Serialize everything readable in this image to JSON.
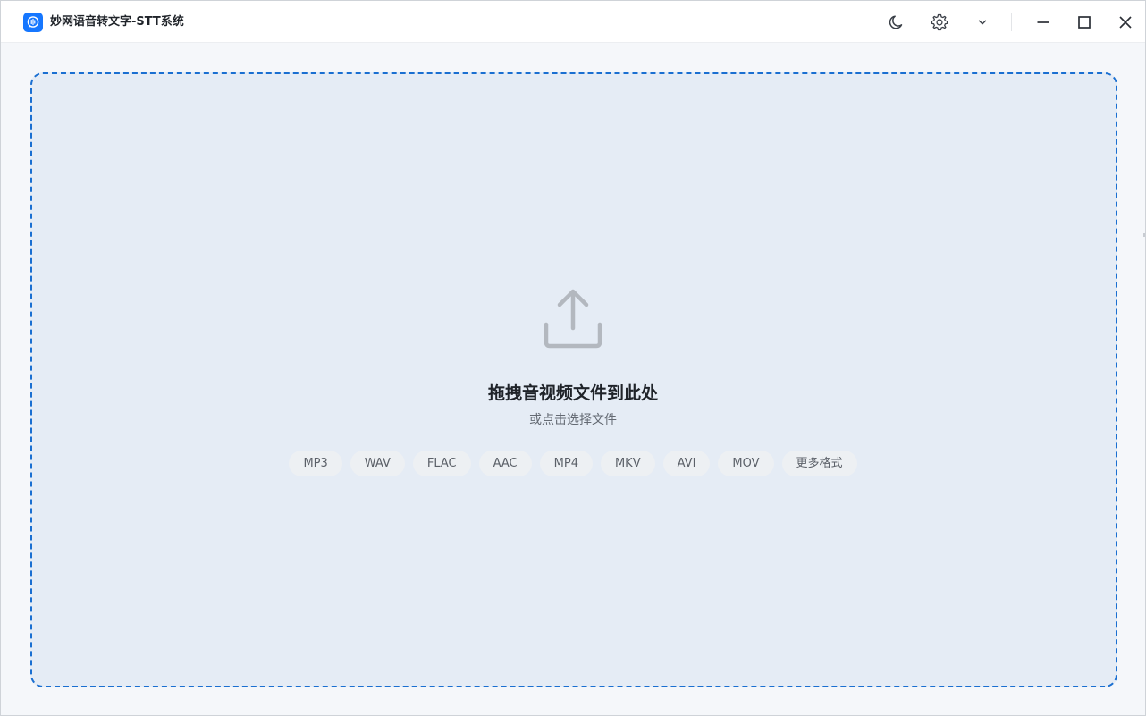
{
  "app": {
    "title": "妙网语音转文字-STT系统",
    "logo_icon": "waveform-chat-icon",
    "accent_color": "#1677ff"
  },
  "titlebar": {
    "buttons": [
      {
        "name": "theme-toggle",
        "icon": "moon-icon"
      },
      {
        "name": "settings",
        "icon": "gear-icon"
      },
      {
        "name": "menu-dropdown",
        "icon": "chevron-down-icon"
      },
      {
        "name": "minimize",
        "icon": "minimize-icon"
      },
      {
        "name": "maximize",
        "icon": "maximize-icon"
      },
      {
        "name": "close",
        "icon": "close-icon"
      }
    ]
  },
  "dropzone": {
    "icon": "upload-icon",
    "title": "拖拽音视频文件到此处",
    "subtitle": "或点击选择文件",
    "border_color": "#1a6fd1",
    "formats": [
      "MP3",
      "WAV",
      "FLAC",
      "AAC",
      "MP4",
      "MKV",
      "AVI",
      "MOV",
      "更多格式"
    ]
  }
}
